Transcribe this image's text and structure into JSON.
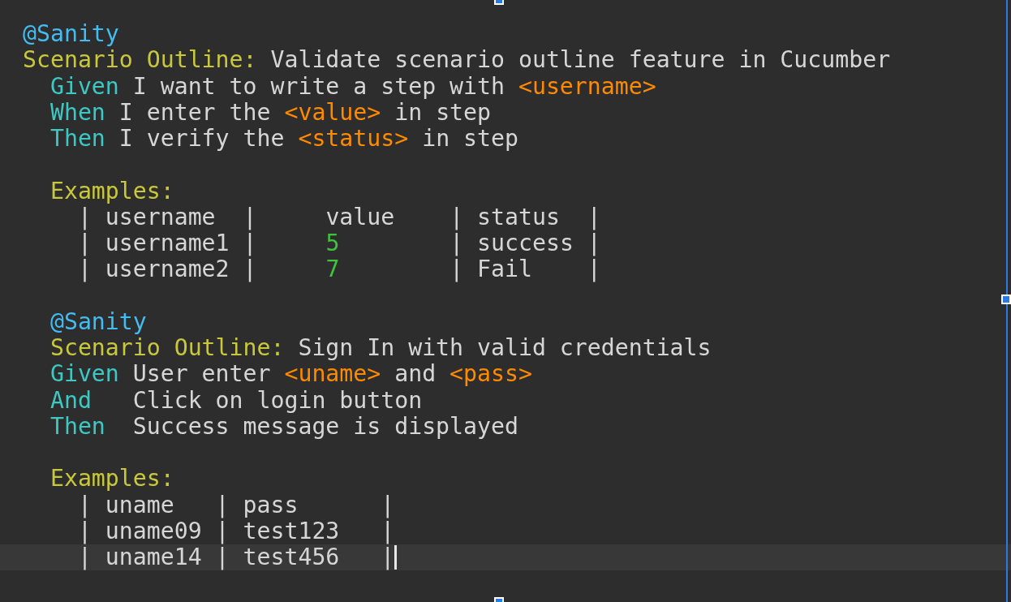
{
  "editor": {
    "lines": [
      {
        "kind": "code",
        "current": false,
        "segments": [
          {
            "kind": "tag",
            "text": "@Sanity"
          }
        ]
      },
      {
        "kind": "code",
        "current": false,
        "segments": [
          {
            "kind": "keyword",
            "text": "Scenario Outline:"
          },
          {
            "kind": "text",
            "text": " Validate scenario outline feature in Cucumber"
          }
        ]
      },
      {
        "kind": "code",
        "current": false,
        "segments": [
          {
            "kind": "step",
            "text": "  Given"
          },
          {
            "kind": "text",
            "text": " I want to write a step with "
          },
          {
            "kind": "param",
            "text": "<username>"
          }
        ]
      },
      {
        "kind": "code",
        "current": false,
        "segments": [
          {
            "kind": "step",
            "text": "  When"
          },
          {
            "kind": "text",
            "text": " I enter the "
          },
          {
            "kind": "param",
            "text": "<value>"
          },
          {
            "kind": "text",
            "text": " in step"
          }
        ]
      },
      {
        "kind": "code",
        "current": false,
        "segments": [
          {
            "kind": "step",
            "text": "  Then"
          },
          {
            "kind": "text",
            "text": " I verify the "
          },
          {
            "kind": "param",
            "text": "<status>"
          },
          {
            "kind": "text",
            "text": " in step"
          }
        ]
      },
      {
        "kind": "blank"
      },
      {
        "kind": "code",
        "current": false,
        "segments": [
          {
            "kind": "keyword",
            "text": "  Examples:"
          }
        ]
      },
      {
        "kind": "code",
        "current": false,
        "segments": [
          {
            "kind": "pipe",
            "text": "    |"
          },
          {
            "kind": "cell",
            "text": " username  "
          },
          {
            "kind": "pipe",
            "text": "|"
          },
          {
            "kind": "cell",
            "text": "     value    "
          },
          {
            "kind": "pipe",
            "text": "|"
          },
          {
            "kind": "cell",
            "text": " status  "
          },
          {
            "kind": "pipe",
            "text": "|"
          }
        ]
      },
      {
        "kind": "code",
        "current": false,
        "segments": [
          {
            "kind": "pipe",
            "text": "    |"
          },
          {
            "kind": "cell",
            "text": " username1 "
          },
          {
            "kind": "pipe",
            "text": "|"
          },
          {
            "kind": "number",
            "text": "     5        "
          },
          {
            "kind": "pipe",
            "text": "|"
          },
          {
            "kind": "cell",
            "text": " success "
          },
          {
            "kind": "pipe",
            "text": "|"
          }
        ]
      },
      {
        "kind": "code",
        "current": false,
        "segments": [
          {
            "kind": "pipe",
            "text": "    |"
          },
          {
            "kind": "cell",
            "text": " username2 "
          },
          {
            "kind": "pipe",
            "text": "|"
          },
          {
            "kind": "number",
            "text": "     7        "
          },
          {
            "kind": "pipe",
            "text": "|"
          },
          {
            "kind": "cell",
            "text": " Fail    "
          },
          {
            "kind": "pipe",
            "text": "|"
          }
        ]
      },
      {
        "kind": "blank"
      },
      {
        "kind": "code",
        "current": false,
        "segments": [
          {
            "kind": "tag",
            "text": "  @Sanity"
          }
        ]
      },
      {
        "kind": "code",
        "current": false,
        "segments": [
          {
            "kind": "keyword",
            "text": "  Scenario Outline:"
          },
          {
            "kind": "text",
            "text": " Sign In with valid credentials"
          }
        ]
      },
      {
        "kind": "code",
        "current": false,
        "segments": [
          {
            "kind": "step",
            "text": "  Given"
          },
          {
            "kind": "text",
            "text": " User enter "
          },
          {
            "kind": "param",
            "text": "<uname>"
          },
          {
            "kind": "text",
            "text": " and "
          },
          {
            "kind": "param",
            "text": "<pass>"
          }
        ]
      },
      {
        "kind": "code",
        "current": false,
        "segments": [
          {
            "kind": "step",
            "text": "  And"
          },
          {
            "kind": "text",
            "text": "   Click on login button"
          }
        ]
      },
      {
        "kind": "code",
        "current": false,
        "segments": [
          {
            "kind": "step",
            "text": "  Then"
          },
          {
            "kind": "text",
            "text": "  Success message is displayed"
          }
        ]
      },
      {
        "kind": "blank"
      },
      {
        "kind": "code",
        "current": false,
        "segments": [
          {
            "kind": "keyword",
            "text": "  Examples:"
          }
        ]
      },
      {
        "kind": "code",
        "current": false,
        "segments": [
          {
            "kind": "pipe",
            "text": "    |"
          },
          {
            "kind": "cell",
            "text": " uname   "
          },
          {
            "kind": "pipe",
            "text": "|"
          },
          {
            "kind": "cell",
            "text": " pass      "
          },
          {
            "kind": "pipe",
            "text": "|"
          }
        ]
      },
      {
        "kind": "code",
        "current": false,
        "segments": [
          {
            "kind": "pipe",
            "text": "    |"
          },
          {
            "kind": "cell",
            "text": " uname09 "
          },
          {
            "kind": "pipe",
            "text": "|"
          },
          {
            "kind": "cell",
            "text": " test123   "
          },
          {
            "kind": "pipe",
            "text": "|"
          }
        ]
      },
      {
        "kind": "code",
        "current": true,
        "segments": [
          {
            "kind": "pipe",
            "text": "    |"
          },
          {
            "kind": "cell",
            "text": " uname14 "
          },
          {
            "kind": "pipe",
            "text": "|"
          },
          {
            "kind": "cell",
            "text": " test456   "
          },
          {
            "kind": "pipe",
            "text": "|"
          }
        ]
      }
    ]
  }
}
